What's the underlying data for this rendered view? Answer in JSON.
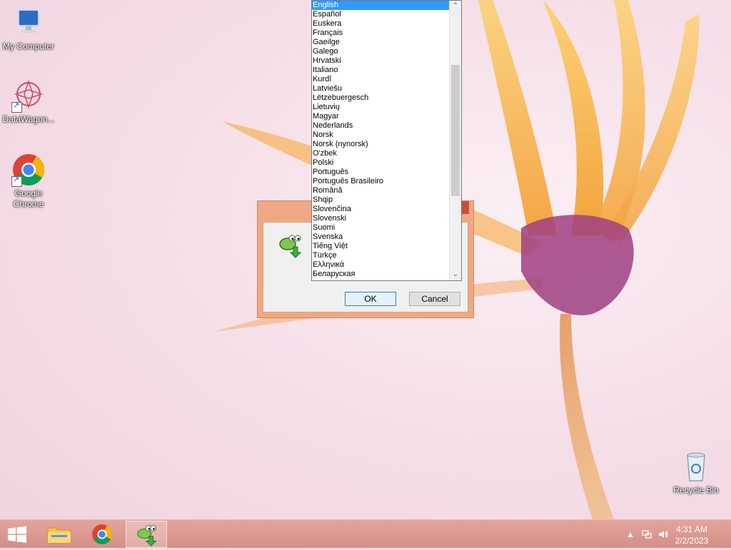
{
  "desktop": {
    "icons": [
      {
        "label": "My Computer"
      },
      {
        "label": "DataWagon..."
      },
      {
        "label": "Google Chrome"
      },
      {
        "label": "Recycle Bin"
      }
    ]
  },
  "dialog": {
    "ok_label": "OK",
    "cancel_label": "Cancel"
  },
  "language_list": {
    "selected": "English",
    "items": [
      "English",
      "Español",
      "Euskera",
      "Français",
      "Gaeilge",
      "Galego",
      "Hrvatski",
      "Italiano",
      "Kurdî",
      "Latviešu",
      "Lëtzebuergesch",
      "Lietuvių",
      "Magyar",
      "Nederlands",
      "Norsk",
      "Norsk (nynorsk)",
      "O'zbek",
      "Polski",
      "Português",
      "Português Brasileiro",
      "Română",
      "Shqip",
      "Slovenčina",
      "Slovenski",
      "Suomi",
      "Svenska",
      "Tiếng Việt",
      "Türkçe",
      "Ελληνικά",
      "Беларуская"
    ]
  },
  "taskbar": {
    "clock_time": "4:31 AM",
    "clock_date": "2/2/2023"
  },
  "colors": {
    "accent": "#f0a884",
    "taskbar": "#d8948c",
    "selection": "#3399ff"
  }
}
